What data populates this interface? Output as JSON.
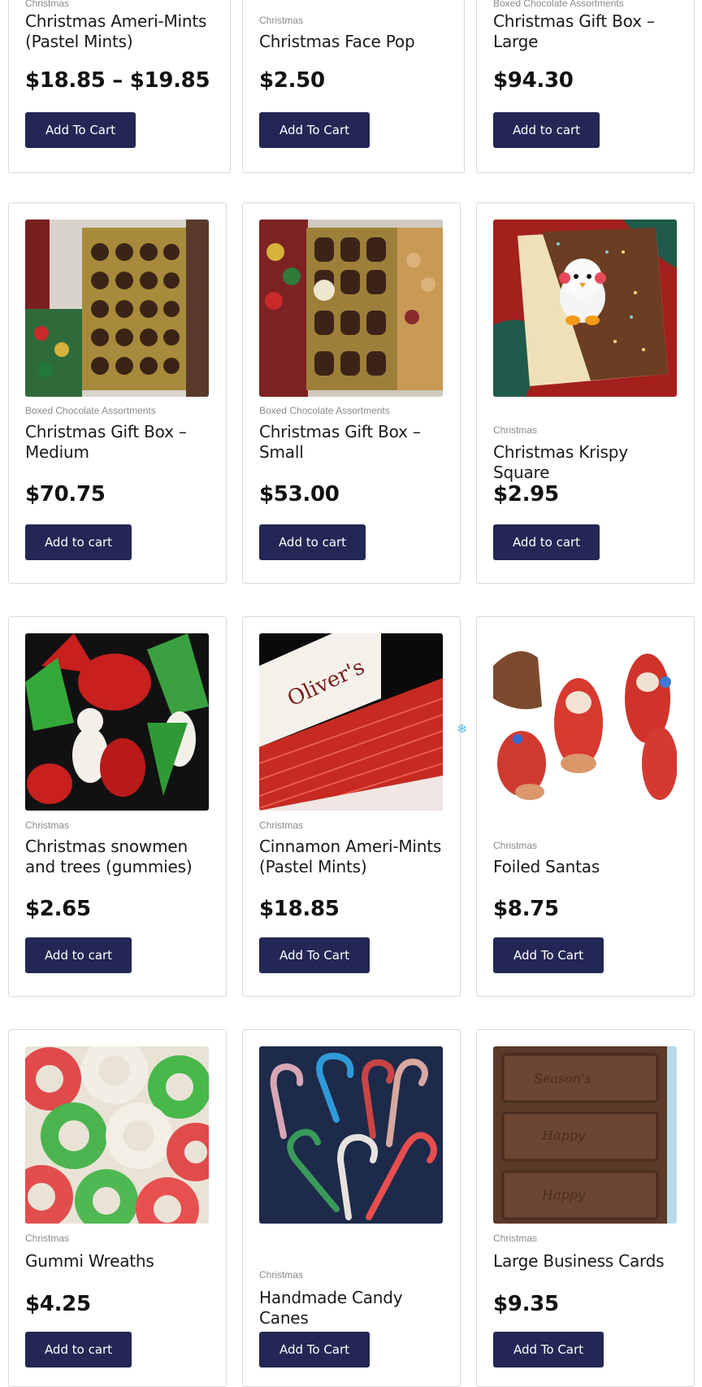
{
  "products": [
    {
      "category": "Christmas",
      "title": "Christmas Ameri-Mints (Pastel Mints)",
      "price": "$18.85 – $19.85",
      "button": "Add To Cart"
    },
    {
      "category": "Christmas",
      "title": "Christmas Face Pop",
      "price": "$2.50",
      "button": "Add To Cart"
    },
    {
      "category": "Boxed Chocolate Assortments",
      "title": "Christmas Gift Box – Large",
      "price": "$94.30",
      "button": "Add to cart"
    },
    {
      "category": "Boxed Chocolate Assortments",
      "title": "Christmas Gift Box – Medium",
      "price": "$70.75",
      "button": "Add to cart",
      "image": "chocolate-gift-box-photo"
    },
    {
      "category": "Boxed Chocolate Assortments",
      "title": "Christmas Gift Box – Small",
      "price": "$53.00",
      "button": "Add to cart",
      "image": "chocolate-gift-box-photo"
    },
    {
      "category": "Christmas",
      "title": "Christmas Krispy Square",
      "price": "$2.95",
      "button": "Add to cart",
      "image": "penguin-krispy-square-photo"
    },
    {
      "category": "Christmas",
      "title": "Christmas snowmen and trees (gummies)",
      "price": "$2.65",
      "button": "Add to cart",
      "image": "gummy-snowmen-photo"
    },
    {
      "category": "Christmas",
      "title": "Cinnamon Ameri-Mints (Pastel Mints)",
      "price": "$18.85",
      "button": "Add To Cart",
      "image": "cinnamon-mints-box-photo"
    },
    {
      "category": "Christmas",
      "title": "Foiled Santas",
      "price": "$8.75",
      "button": "Add To Cart",
      "image": "foiled-santas-photo"
    },
    {
      "category": "Christmas",
      "title": "Gummi Wreaths",
      "price": "$4.25",
      "button": "Add to cart",
      "image": "gummi-wreaths-photo"
    },
    {
      "category": "Christmas",
      "title": "Handmade Candy Canes",
      "price": "",
      "button": "Add To Cart",
      "image": "candy-canes-photo"
    },
    {
      "category": "Christmas",
      "title": "Large Business Cards",
      "price": "$9.35",
      "button": "Add To Cart",
      "image": "chocolate-business-cards-photo"
    }
  ],
  "decor": {
    "snowflake": "❄"
  }
}
